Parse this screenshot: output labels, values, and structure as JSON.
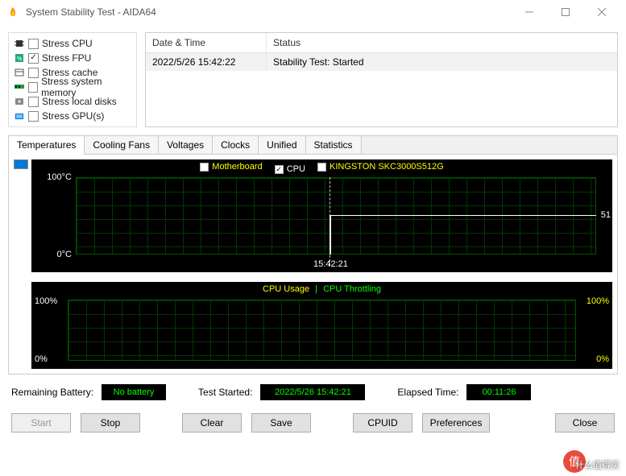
{
  "window": {
    "title": "System Stability Test - AIDA64"
  },
  "stress": {
    "items": [
      {
        "label": "Stress CPU",
        "checked": false
      },
      {
        "label": "Stress FPU",
        "checked": true
      },
      {
        "label": "Stress cache",
        "checked": false
      },
      {
        "label": "Stress system memory",
        "checked": false
      },
      {
        "label": "Stress local disks",
        "checked": false
      },
      {
        "label": "Stress GPU(s)",
        "checked": false
      }
    ]
  },
  "log": {
    "headers": {
      "date": "Date & Time",
      "status": "Status"
    },
    "row": {
      "date": "2022/5/26 15:42:22",
      "status": "Stability Test: Started"
    }
  },
  "tabs": [
    "Temperatures",
    "Cooling Fans",
    "Voltages",
    "Clocks",
    "Unified",
    "Statistics"
  ],
  "graph1": {
    "series": {
      "mb": "Motherboard",
      "cpu": "CPU",
      "ssd": "KINGSTON SKC3000S512G"
    },
    "ymax": "100°C",
    "ymin": "0°C",
    "xmark": "15:42:21",
    "value": "51"
  },
  "graph2": {
    "legend_usage": "CPU Usage",
    "legend_sep": "|",
    "legend_throttle": "CPU Throttling",
    "left_top": "100%",
    "left_bot": "0%",
    "right_top": "100%",
    "right_bot": "0%"
  },
  "status": {
    "battery_label": "Remaining Battery:",
    "battery_val": "No battery",
    "started_label": "Test Started:",
    "started_val": "2022/5/26 15:42:21",
    "elapsed_label": "Elapsed Time:",
    "elapsed_val": "00:11:26"
  },
  "buttons": {
    "start": "Start",
    "stop": "Stop",
    "clear": "Clear",
    "save": "Save",
    "cpuid": "CPUID",
    "prefs": "Preferences",
    "close": "Close"
  },
  "watermark": "什么值得买",
  "chart_data": [
    {
      "type": "line",
      "title": "Temperature",
      "ylabel": "°C",
      "ylim": [
        0,
        100
      ],
      "x_marker": "15:42:21",
      "series": [
        {
          "name": "CPU",
          "value_after_marker": 51
        }
      ],
      "available_series": [
        "Motherboard",
        "CPU",
        "KINGSTON SKC3000S512G"
      ],
      "visible_series": [
        "CPU"
      ]
    },
    {
      "type": "line",
      "title": "CPU Usage / Throttling",
      "ylim_left": [
        0,
        100
      ],
      "yunit_left": "%",
      "ylim_right": [
        0,
        100
      ],
      "yunit_right": "%",
      "series": [
        {
          "name": "CPU Usage",
          "axis": "left"
        },
        {
          "name": "CPU Throttling",
          "axis": "right"
        }
      ]
    }
  ]
}
